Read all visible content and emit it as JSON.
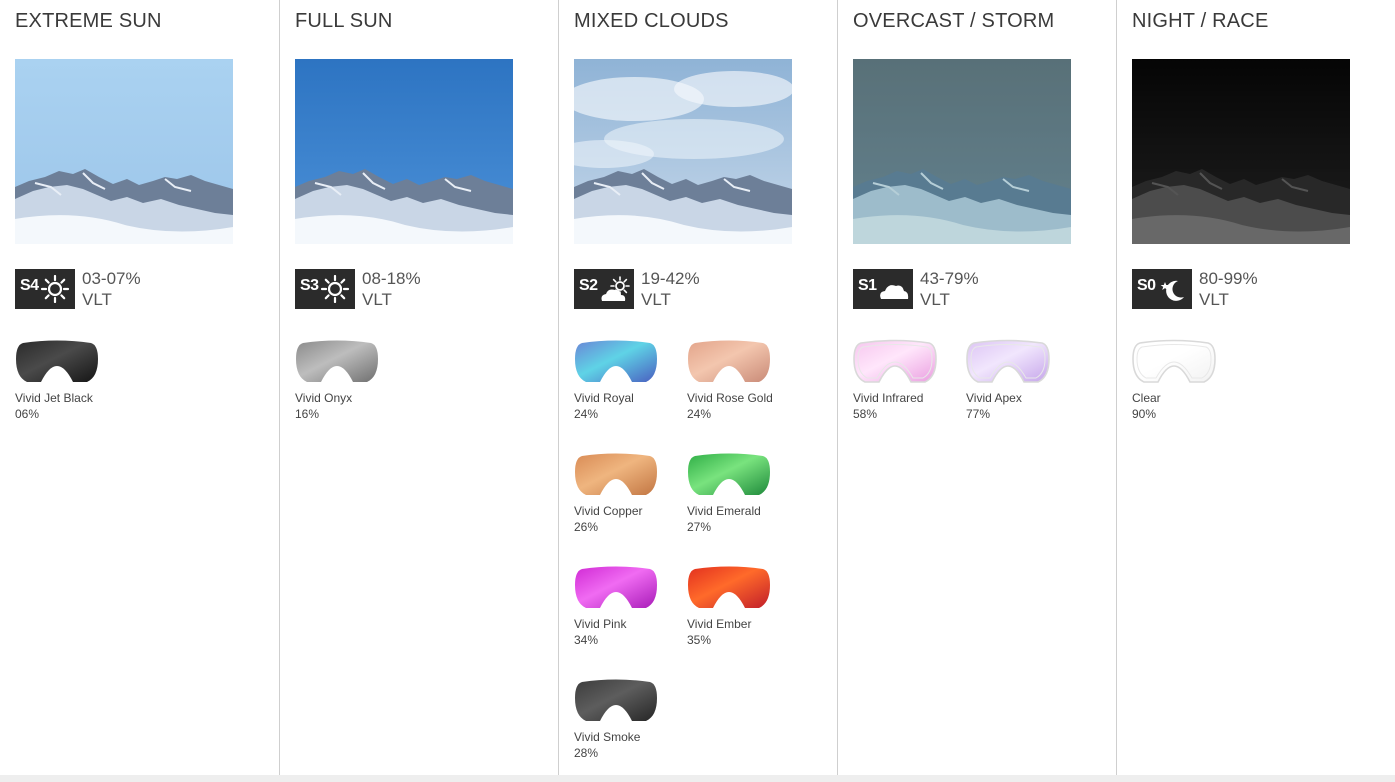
{
  "columns": [
    {
      "title": "EXTREME SUN",
      "category": "S4",
      "icon": "sun-icon",
      "vlt_range": "03-07%",
      "vlt_label": "VLT",
      "sky": {
        "top": "#aad2f1",
        "bottom": "#9cc5e9"
      },
      "tint": {
        "color": "#ffffff",
        "opacity": 0
      },
      "lenses": [
        {
          "name": "Vivid Jet Black",
          "vlt": "06%",
          "colors": [
            "#2a2a2a",
            "#4a4a4a",
            "#151515"
          ],
          "outline": false
        }
      ]
    },
    {
      "title": "FULL SUN",
      "category": "S3",
      "icon": "sun-icon",
      "vlt_range": "08-18%",
      "vlt_label": "VLT",
      "sky": {
        "top": "#2d74c2",
        "bottom": "#4c91d8"
      },
      "tint": {
        "color": "#ffffff",
        "opacity": 0
      },
      "lenses": [
        {
          "name": "Vivid Onyx",
          "vlt": "16%",
          "colors": [
            "#8a8a8a",
            "#bdbdbd",
            "#6f6f6f"
          ],
          "outline": false
        }
      ]
    },
    {
      "title": "MIXED CLOUDS",
      "category": "S2",
      "icon": "sun-cloud-icon",
      "vlt_range": "19-42%",
      "vlt_label": "VLT",
      "sky": {
        "top": "#8fb3d6",
        "bottom": "#c6d8ea"
      },
      "tint": {
        "color": "#ffffff",
        "opacity": 0
      },
      "clouds": true,
      "lenses": [
        {
          "name": "Vivid Royal",
          "vlt": "24%",
          "colors": [
            "#6a86d6",
            "#5fd3e6",
            "#4a5fc0"
          ],
          "outline": false
        },
        {
          "name": "Vivid Rose Gold",
          "vlt": "24%",
          "colors": [
            "#e3a48a",
            "#f3c6ae",
            "#c98a77"
          ],
          "outline": false
        },
        {
          "name": "Vivid Copper",
          "vlt": "26%",
          "colors": [
            "#d98b55",
            "#efb57f",
            "#c27643"
          ],
          "outline": false
        },
        {
          "name": "Vivid Emerald",
          "vlt": "27%",
          "colors": [
            "#2fae46",
            "#79e37e",
            "#1f8a3b"
          ],
          "outline": false
        },
        {
          "name": "Vivid Pink",
          "vlt": "34%",
          "colors": [
            "#d02ad4",
            "#f06bf2",
            "#a81cb8"
          ],
          "outline": false
        },
        {
          "name": "Vivid Ember",
          "vlt": "35%",
          "colors": [
            "#e2301f",
            "#ff6a2a",
            "#c11e2a"
          ],
          "outline": false
        },
        {
          "name": "Vivid Smoke",
          "vlt": "28%",
          "colors": [
            "#3c3c3c",
            "#5d5d5d",
            "#262626"
          ],
          "outline": false
        }
      ]
    },
    {
      "title": "OVERCAST / STORM",
      "category": "S1",
      "icon": "cloud-icon",
      "vlt_range": "43-79%",
      "vlt_label": "VLT",
      "sky": {
        "top": "#6d7177",
        "bottom": "#7b8794"
      },
      "tint": {
        "color": "#1a6e7a",
        "opacity": 0.25
      },
      "lenses": [
        {
          "name": "Vivid Infrared",
          "vlt": "58%",
          "colors": [
            "#f6c6ee",
            "#ffe6fb",
            "#ea9ee0"
          ],
          "outline": true
        },
        {
          "name": "Vivid Apex",
          "vlt": "77%",
          "colors": [
            "#dcc4f4",
            "#f1e6fd",
            "#c5a5ea"
          ],
          "outline": true
        }
      ]
    },
    {
      "title": "NIGHT / RACE",
      "category": "S0",
      "icon": "moon-star-icon",
      "vlt_range": "80-99%",
      "vlt_label": "VLT",
      "sky": {
        "top": "#0a0a0a",
        "bottom": "#3a3a3a"
      },
      "tint": {
        "color": "#000000",
        "opacity": 0.45
      },
      "grayscale": true,
      "lenses": [
        {
          "name": "Clear",
          "vlt": "90%",
          "colors": [
            "#ffffff",
            "#ffffff",
            "#f2f2f2"
          ],
          "outline": true
        }
      ]
    }
  ]
}
